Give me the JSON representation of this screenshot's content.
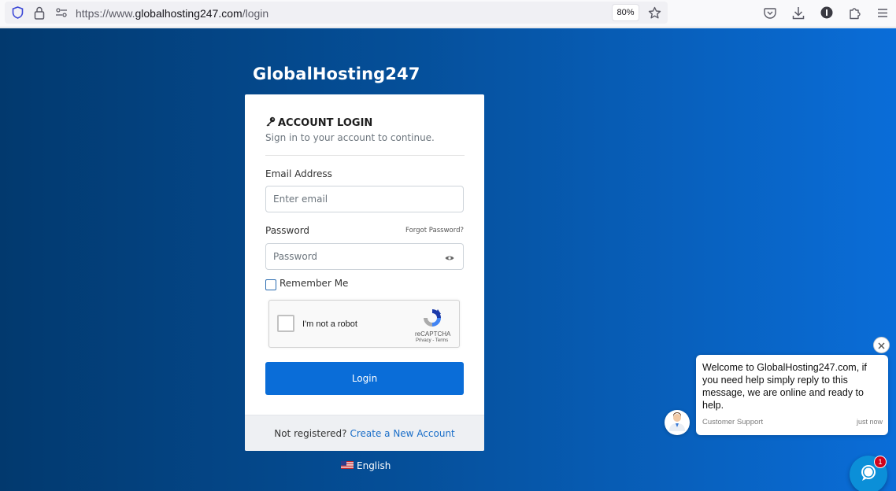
{
  "browser": {
    "url_prefix": "https://www.",
    "url_host": "globalhosting247.com",
    "url_path": "/login",
    "zoom": "80%",
    "icons": [
      "shield-icon",
      "lock-icon",
      "permissions-icon",
      "bookmark-star-icon",
      "pocket-icon",
      "download-icon",
      "extension-info-icon",
      "extensions-puzzle-icon",
      "menu-icon"
    ]
  },
  "page": {
    "brand": "GlobalHosting247",
    "background_colors": [
      "#02396e",
      "#0a6dd8"
    ],
    "login": {
      "title": "ACCOUNT LOGIN",
      "title_icon": "key-icon",
      "subtitle": "Sign in to your account to continue.",
      "email_label": "Email Address",
      "email_placeholder": "Enter email",
      "password_label": "Password",
      "forgot_link": "Forgot Password?",
      "password_placeholder": "Password",
      "show_password_icon": "eye-icon",
      "remember_label": "Remember Me",
      "remember_checked": false,
      "captcha": {
        "text": "I'm not a robot",
        "brand": "reCAPTCHA",
        "terms": "Privacy - Terms"
      },
      "submit_label": "Login",
      "accent_color": "#0a6dd8"
    },
    "footer": {
      "prompt": "Not registered?",
      "link": "Create a New Account"
    },
    "language": {
      "label": "English",
      "flag_icon": "us-flag-icon"
    }
  },
  "chat": {
    "message": "Welcome to GlobalHosting247.com, if you need help simply reply to this message, we are online and ready to help.",
    "sender": "Customer Support",
    "time": "just now",
    "unread_count": "1"
  }
}
